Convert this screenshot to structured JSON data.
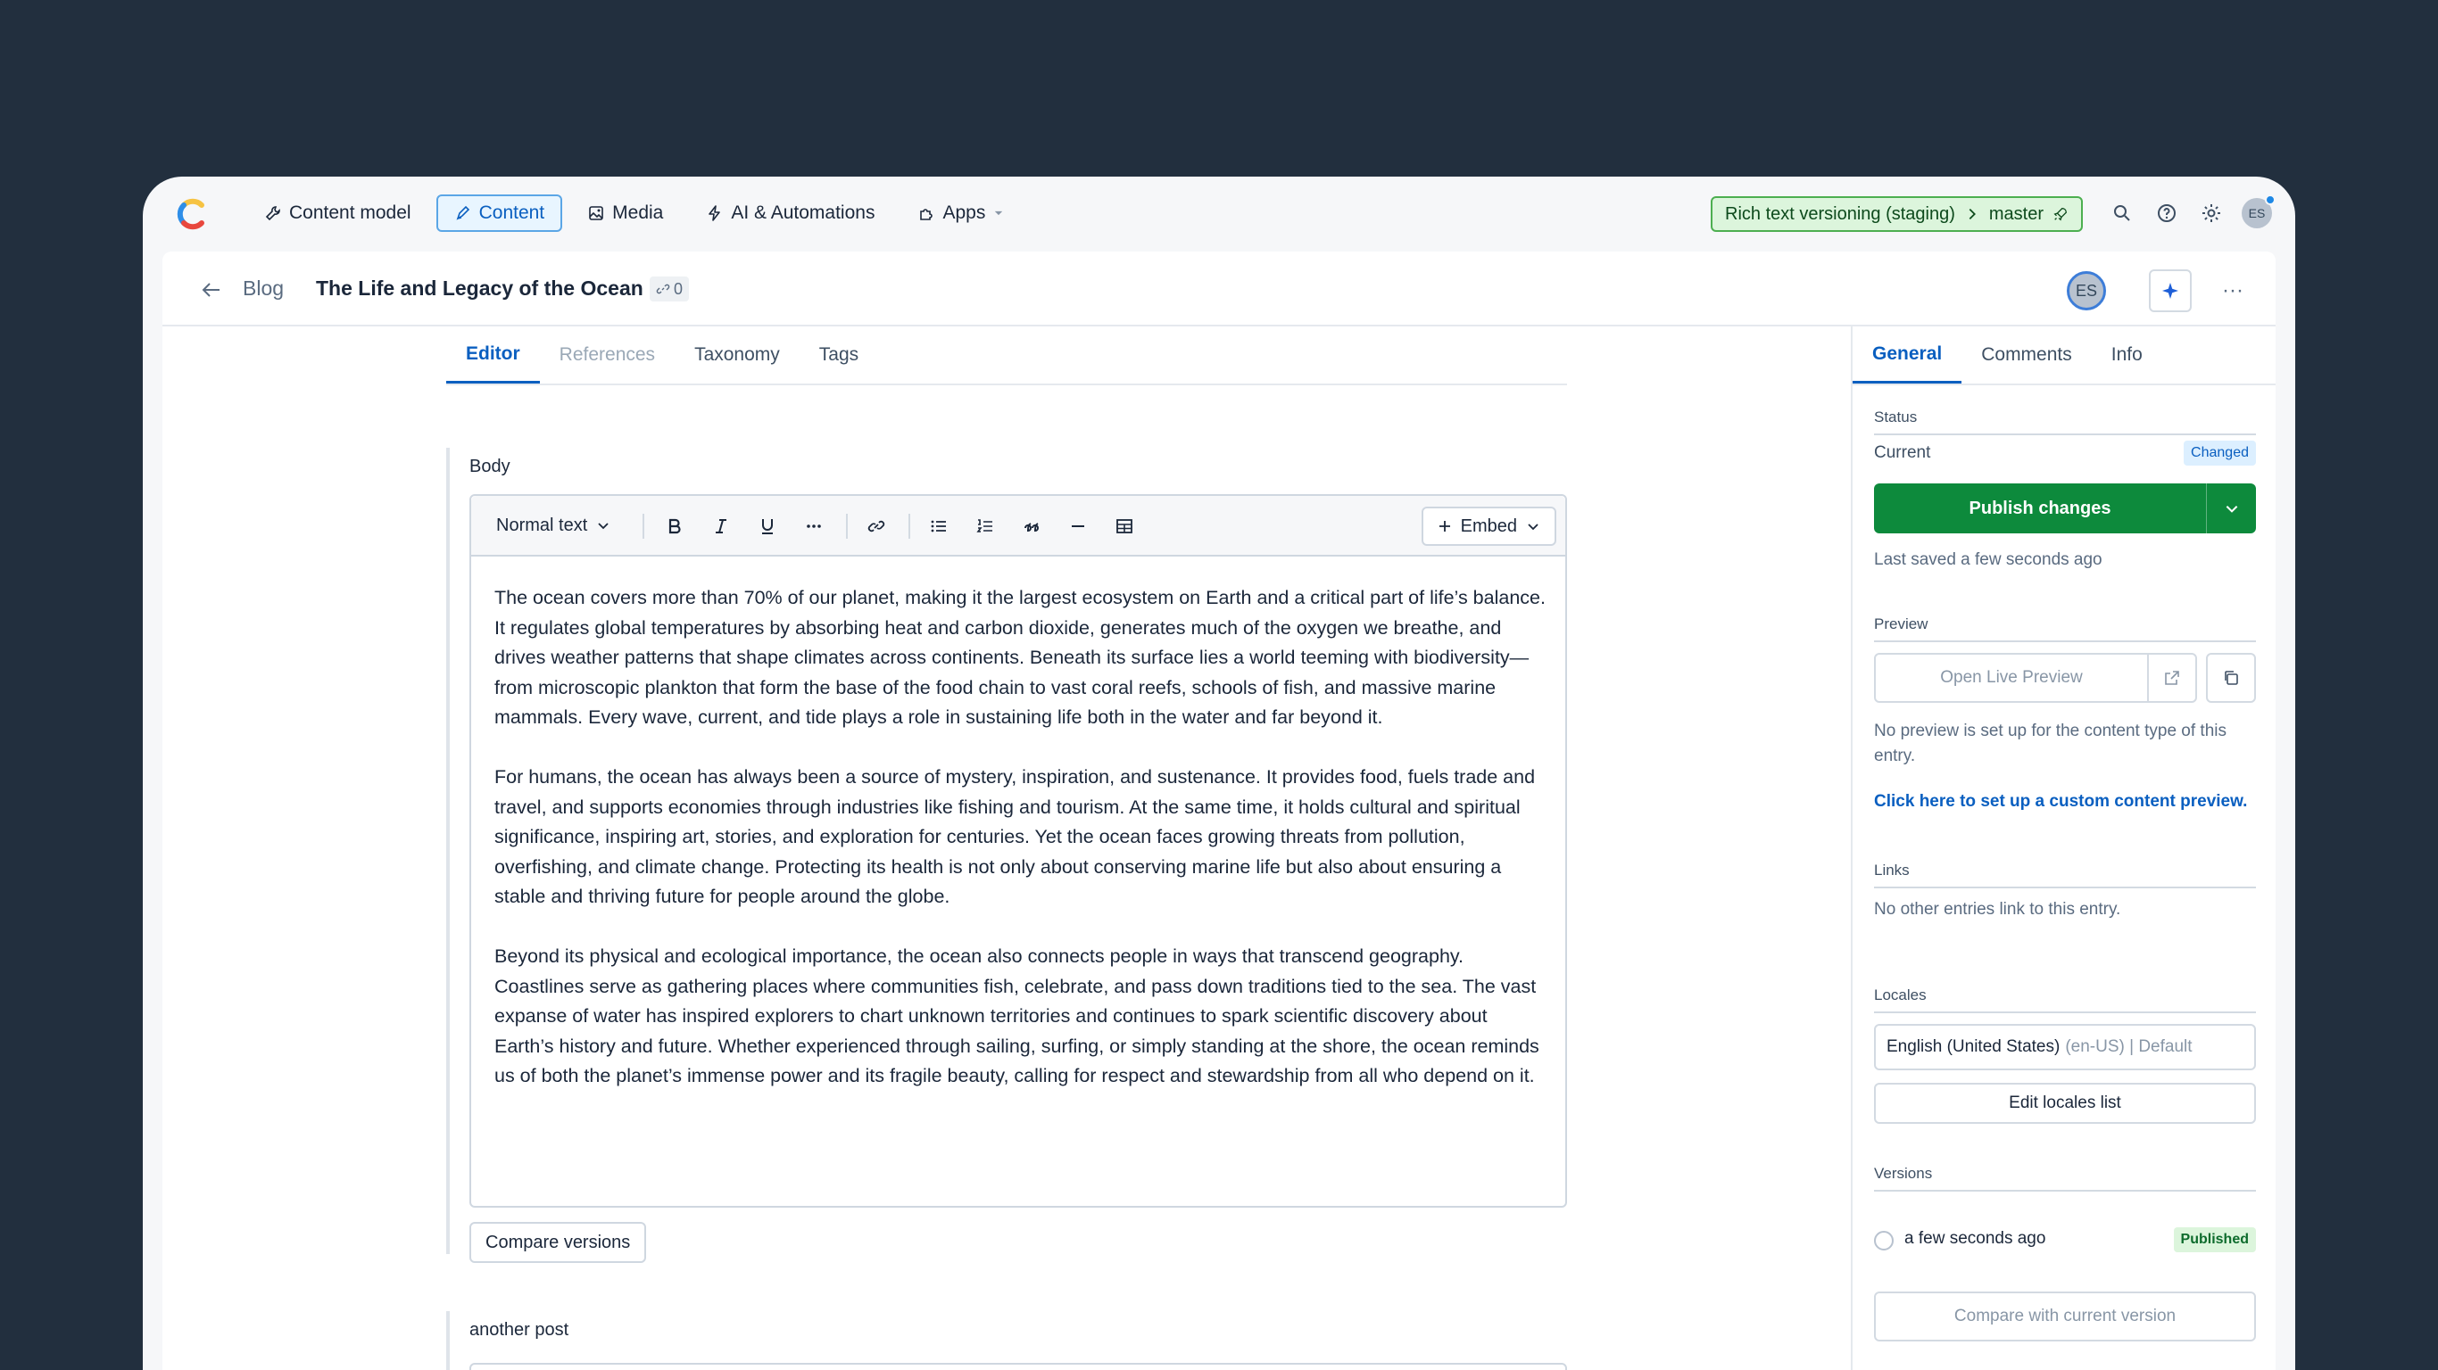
{
  "nav": {
    "items": [
      {
        "label": "Content model",
        "icon": "wrench-icon"
      },
      {
        "label": "Content",
        "icon": "pen-icon",
        "active": true
      },
      {
        "label": "Media",
        "icon": "image-icon"
      },
      {
        "label": "AI & Automations",
        "icon": "bolt-icon"
      },
      {
        "label": "Apps",
        "icon": "puzzle-icon"
      }
    ],
    "space": "Rich text versioning (staging)",
    "environment": "master",
    "avatar_initials": "ES"
  },
  "entry": {
    "breadcrumb": "Blog",
    "title": "The Life and Legacy of the Ocean",
    "link_count": "0",
    "avatar_initials": "ES"
  },
  "tabs": [
    "Editor",
    "References",
    "Taxonomy",
    "Tags"
  ],
  "body_field": {
    "label": "Body",
    "format": "Normal text",
    "embed_label": "Embed",
    "paragraphs": [
      "The ocean covers more than 70% of our planet, making it the largest ecosystem on Earth and a critical part of life’s balance. It regulates global temperatures by absorbing heat and carbon dioxide, generates much of the oxygen we breathe, and drives weather patterns that shape climates across continents. Beneath its surface lies a world teeming with biodiversity—from microscopic plankton that form the base of the food chain to vast coral reefs, schools of fish, and massive marine mammals. Every wave, current, and tide plays a role in sustaining life both in the water and far beyond it.",
      "For humans, the ocean has always been a source of mystery, inspiration, and sustenance. It provides food, fuels trade and travel, and supports economies through industries like fishing and tourism. At the same time, it holds cultural and spiritual significance, inspiring art, stories, and exploration for centuries. Yet the ocean faces growing threats from pollution, overfishing, and climate change. Protecting its health is not only about conserving marine life but also about ensuring a stable and thriving future for people around the globe.",
      "Beyond its physical and ecological importance, the ocean also connects people in ways that transcend geography. Coastlines serve as gathering places where communities fish, celebrate, and pass down traditions tied to the sea. The vast expanse of water has inspired explorers to chart unknown territories and continues to spark scientific discovery about Earth’s history and future. Whether experienced through sailing, surfing, or simply standing at the shore, the ocean reminds us of both the planet’s immense power and its fragile beauty, calling for respect and stewardship from all who depend on it."
    ],
    "compare_label": "Compare versions"
  },
  "second_field": {
    "label": "another post"
  },
  "sidebar": {
    "tabs": [
      "General",
      "Comments",
      "Info"
    ],
    "status": {
      "title": "Status",
      "current_label": "Current",
      "badge": "Changed",
      "publish_label": "Publish changes",
      "last_saved": "Last saved a few seconds ago"
    },
    "preview": {
      "title": "Preview",
      "open_label": "Open Live Preview",
      "note": "No preview is set up for the content type of this entry.",
      "setup_link": "Click here to set up a custom content preview."
    },
    "links": {
      "title": "Links",
      "note": "No other entries link to this entry."
    },
    "locales": {
      "title": "Locales",
      "locale_name": "English (United States)",
      "locale_meta": "(en-US) | Default",
      "edit_label": "Edit locales list"
    },
    "versions": {
      "title": "Versions",
      "entry_time": "a few seconds ago",
      "entry_badge": "Published",
      "compare_label": "Compare with current version"
    }
  },
  "colors": {
    "accent": "#0a5fc0",
    "publish": "#0d8a3c",
    "background": "#222f3e"
  }
}
